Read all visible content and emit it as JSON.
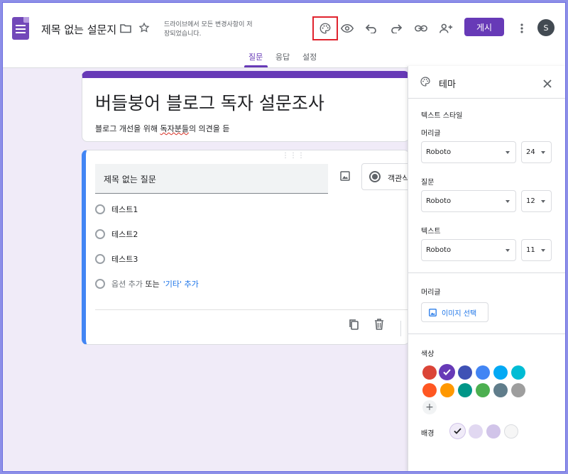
{
  "header": {
    "doc_title": "제목 없는 설문지",
    "save_status": "드라이브에서 모든 변경사항이 저장되었습니다.",
    "publish_label": "게시",
    "avatar_initial": "S"
  },
  "tabs": [
    {
      "label": "질문",
      "active": true
    },
    {
      "label": "응답",
      "active": false
    },
    {
      "label": "설정",
      "active": false
    }
  ],
  "form": {
    "title": "버들붕어 블로그 독자 설문조사",
    "description_plain": "블로그 개선을 위해 ",
    "description_marked": "독자분들",
    "description_rest": "의 의견을 듣"
  },
  "question": {
    "title": "제목 없는 질문",
    "type": "객관식 질문",
    "options": [
      "테스트1",
      "테스트2",
      "테스트3"
    ],
    "add_option": "옵션 추가",
    "or_text": "또는",
    "add_other": "'기타' 추가"
  },
  "theme_panel": {
    "title": "테마",
    "text_style_label": "텍스트 스타일",
    "header_label": "머리글",
    "header_font": "Roboto",
    "header_size": "24",
    "question_label": "질문",
    "question_font": "Roboto",
    "question_size": "12",
    "text_label": "텍스트",
    "text_font": "Roboto",
    "text_size": "11",
    "header_image_label": "머리글",
    "image_select_label": "이미지 선택",
    "color_label": "색상",
    "colors_row1": [
      "#db4437",
      "#673ab7",
      "#3f51b5",
      "#4285f4",
      "#03a9f4",
      "#00bcd4"
    ],
    "colors_row2": [
      "#ff5722",
      "#ff9800",
      "#009688",
      "#4caf50",
      "#607d8b",
      "#9e9e9e"
    ],
    "selected_color": "#673ab7",
    "background_label": "배경",
    "backgrounds": [
      "#f0ebf8",
      "#e1d8f1",
      "#d1c4e9",
      "#f6f6f6"
    ]
  }
}
